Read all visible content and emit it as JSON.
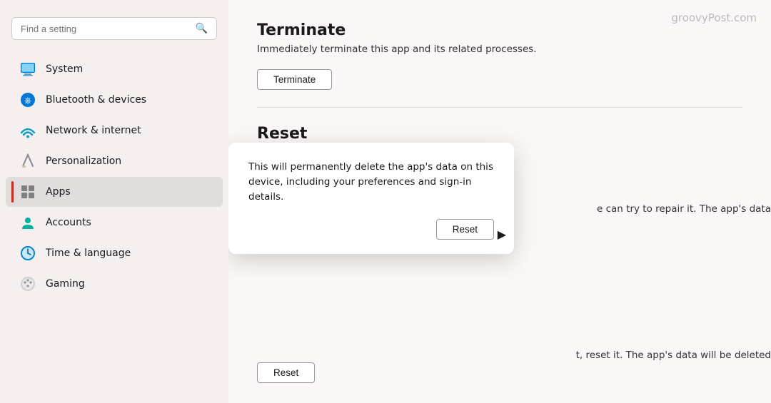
{
  "sidebar": {
    "search_placeholder": "Find a setting",
    "items": [
      {
        "id": "system",
        "label": "System",
        "icon": "system"
      },
      {
        "id": "bluetooth",
        "label": "Bluetooth & devices",
        "icon": "bluetooth"
      },
      {
        "id": "network",
        "label": "Network & internet",
        "icon": "network"
      },
      {
        "id": "personalization",
        "label": "Personalization",
        "icon": "personalization"
      },
      {
        "id": "apps",
        "label": "Apps",
        "icon": "apps",
        "active": true
      },
      {
        "id": "accounts",
        "label": "Accounts",
        "icon": "accounts"
      },
      {
        "id": "time",
        "label": "Time & language",
        "icon": "time"
      },
      {
        "id": "gaming",
        "label": "Gaming",
        "icon": "gaming"
      }
    ]
  },
  "main": {
    "watermark": "groovyPost.com",
    "terminate_title": "Terminate",
    "terminate_desc": "Immediately terminate this app and its related processes.",
    "terminate_btn": "Terminate",
    "reset_title": "Reset",
    "reset_truncated": "e can try to repair it. The app's data",
    "reset_truncated2": "t, reset it. The app's data will be deleted",
    "reset_btn": "Reset"
  },
  "dialog": {
    "text": "This will permanently delete the app's data on this device, including your preferences and sign-in details.",
    "reset_btn": "Reset"
  }
}
